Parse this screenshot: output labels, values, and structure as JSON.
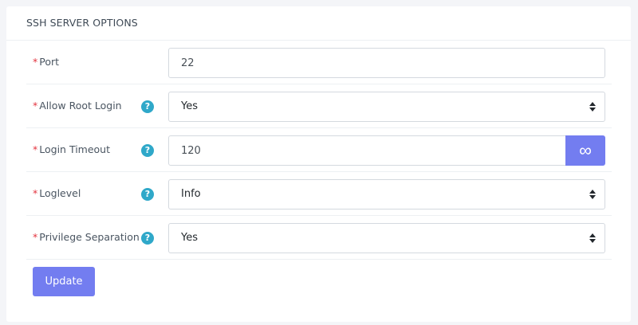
{
  "header": {
    "title": "SSH SERVER OPTIONS"
  },
  "required_mark": "*",
  "help_glyph": "?",
  "fields": {
    "port": {
      "label": "Port",
      "value": "22"
    },
    "root_login": {
      "label": "Allow Root Login",
      "value": "Yes"
    },
    "login_timeout": {
      "label": "Login Timeout",
      "value": "120",
      "button_glyph": "∞"
    },
    "loglevel": {
      "label": "Loglevel",
      "value": "Info"
    },
    "privilege_separation": {
      "label": "Privilege Separation",
      "value": "Yes"
    }
  },
  "update_label": "Update",
  "colors": {
    "accent": "#737df0",
    "help": "#2fa8c9",
    "required": "#e3343f"
  },
  "icons": {
    "help": "question-circle-icon",
    "select": "sort-caret-icon",
    "unlimited": "infinity-icon"
  }
}
